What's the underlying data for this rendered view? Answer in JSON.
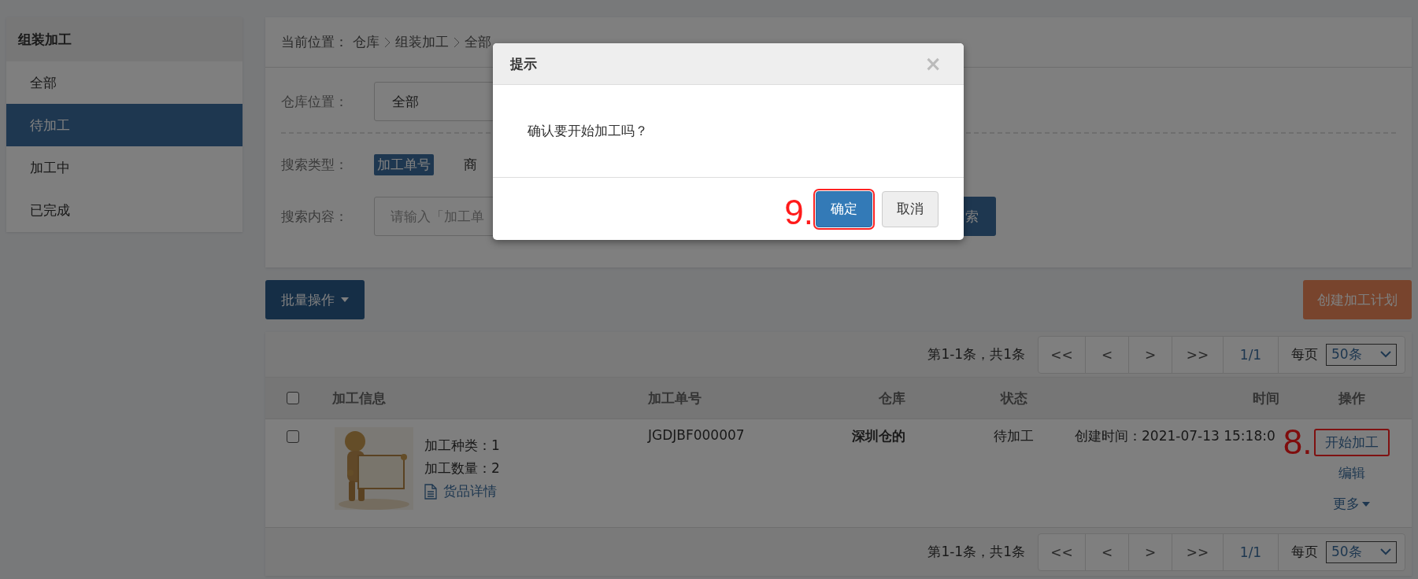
{
  "sidebar": {
    "title": "组装加工",
    "items": [
      {
        "label": "全部",
        "selected": false
      },
      {
        "label": "待加工",
        "selected": true
      },
      {
        "label": "加工中",
        "selected": false
      },
      {
        "label": "已完成",
        "selected": false
      }
    ]
  },
  "breadcrumb": {
    "label": "当前位置：",
    "path": [
      "仓库",
      "组装加工",
      "全部"
    ]
  },
  "filters": {
    "warehouse": {
      "label": "仓库位置：",
      "value": "全部"
    },
    "search_type": {
      "label": "搜索类型：",
      "options": [
        {
          "label": "加工单号",
          "selected": true
        },
        {
          "label": "商",
          "selected": false
        }
      ]
    },
    "search_content": {
      "label": "搜索内容：",
      "placeholder": "请输入「加工单"
    },
    "search_button": "索"
  },
  "toolbar": {
    "batch_button": "批量操作",
    "create_button": "创建加工计划"
  },
  "pagination_top": {
    "summary": "第1-1条，共1条",
    "buttons": [
      "<<",
      "<",
      ">",
      ">>"
    ],
    "page": "1/1",
    "per_page_label": "每页",
    "per_page": "50条"
  },
  "table": {
    "header_checked": false,
    "columns": [
      "加工信息",
      "加工单号",
      "仓库",
      "状态",
      "时间",
      "操作"
    ],
    "rows": [
      {
        "checked": false,
        "picture": {
          "kind": "picture"
        },
        "kinds": "加工种类：1",
        "quantity": "加工数量：2",
        "detail_link": "货品详情",
        "order_no": "JGDJBF000007",
        "warehouse": "深圳仓的",
        "status": "待加工",
        "time": "创建时间：2021-07-13 15:18:0",
        "actions": [
          {
            "label": "开始加工",
            "annotation": "8."
          },
          {
            "label": "编辑"
          },
          {
            "label": "更多",
            "kind": "dropdown"
          }
        ]
      }
    ]
  },
  "pagination_bottom": {
    "summary": "第1-1条，共1条",
    "buttons": [
      "<<",
      "<",
      ">",
      ">>"
    ],
    "page": "1/1",
    "per_page_label": "每页",
    "per_page": "50条"
  },
  "dialog": {
    "title": "提示",
    "close": "×",
    "message": "确认要开始加工吗？",
    "buttons": [
      {
        "label": "确定",
        "kind": "primary",
        "annotation": "9."
      },
      {
        "label": "取消",
        "kind": "default"
      }
    ]
  }
}
